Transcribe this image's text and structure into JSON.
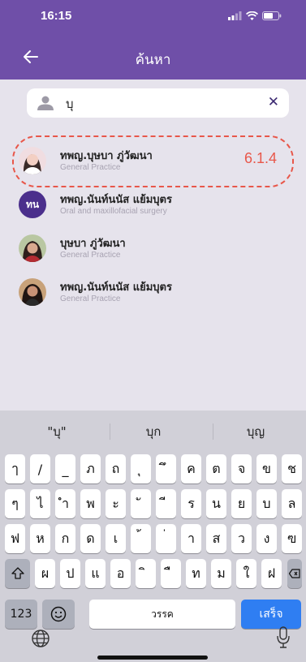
{
  "status_bar": {
    "time": "16:15"
  },
  "header": {
    "title": "ค้นหา"
  },
  "search": {
    "value": "บุ"
  },
  "results": [
    {
      "name": "ทพญ.บุษบา ภู่วัฒนา",
      "specialty": "General Practice",
      "avatar": "photo"
    },
    {
      "name": "ทพญ.นันท์นนัส แย้มบุตร",
      "specialty": "Oral and maxillofacial surgery",
      "avatar_initials": "ทน"
    },
    {
      "name": "บุษบา ภู่วัฒนา",
      "specialty": "General Practice",
      "avatar": "photo"
    },
    {
      "name": "ทพญ.นันท์นนัส แย้มบุตร",
      "specialty": "General Practice",
      "avatar": "photo"
    }
  ],
  "annotation": {
    "label": "6.1.4"
  },
  "keyboard": {
    "suggestions": [
      "\"บุ\"",
      "บุก",
      "บุญ"
    ],
    "row1": [
      "ๅ",
      "/",
      "_",
      "ภ",
      "ถ",
      "ุ",
      "ึ",
      "ค",
      "ต",
      "จ",
      "ข",
      "ช"
    ],
    "row2": [
      "ๆ",
      "ไ",
      "ำ",
      "พ",
      "ะ",
      "ั",
      "ี",
      "ร",
      "น",
      "ย",
      "บ",
      "ล"
    ],
    "row3": [
      "ฟ",
      "ห",
      "ก",
      "ด",
      "เ",
      "้",
      "่",
      "า",
      "ส",
      "ว",
      "ง",
      "ฃ"
    ],
    "row4": [
      "ผ",
      "ป",
      "แ",
      "อ",
      "ิ",
      "ื",
      "ท",
      "ม",
      "ใ",
      "ฝ"
    ],
    "numbers_label": "123",
    "space_label": "วรรค",
    "return_label": "เสร็จ"
  },
  "colors": {
    "header": "#6f4fa8",
    "annotation": "#e8574a",
    "return_key": "#2f7ef2"
  }
}
